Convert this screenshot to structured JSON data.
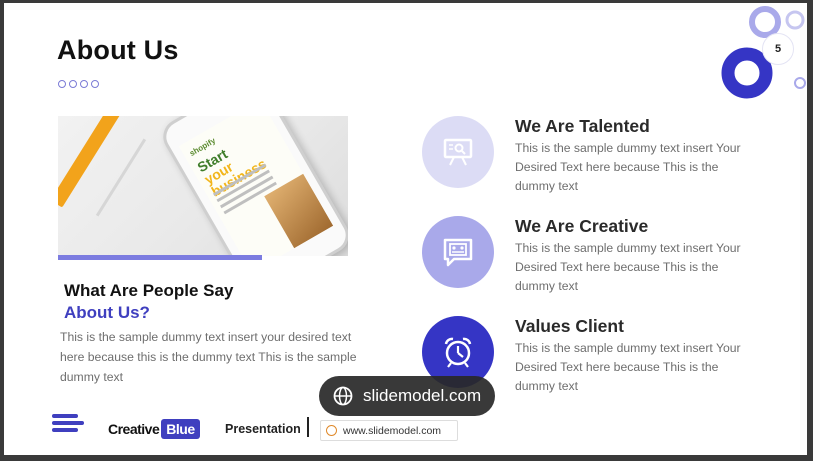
{
  "slide": {
    "title": "About Us",
    "page_number": "5",
    "left": {
      "subtitle_line1": "What Are People Say",
      "subtitle_line2": "About Us?",
      "body": "This is the sample dummy  text insert your desired text here because this is the dummy  text This is the sample dummy  text",
      "phone_brand": "shopify",
      "phone_headline_1": "Start",
      "phone_headline_2": "your business"
    },
    "features": [
      {
        "title": "We Are Talented",
        "text": "This is the sample dummy  text insert Your Desired Text here because This is the dummy  text",
        "icon": "presentation-board-icon",
        "circle_color": "#dcdcf5"
      },
      {
        "title": "We Are Creative",
        "text": "This is the sample dummy  text insert Your Desired Text here because This is the dummy  text",
        "icon": "chat-presentation-icon",
        "circle_color": "#a9a9ea"
      },
      {
        "title": "Values Client",
        "text": "This is the sample dummy  text insert Your Desired Text here because This is the dummy  text",
        "icon": "alarm-clock-icon",
        "circle_color": "#3535c5"
      }
    ],
    "footer": {
      "brand_word": "Creative",
      "brand_badge": "Blue",
      "presentation_label": "Presentation",
      "url": "www.slidemodel.com"
    }
  },
  "watermark": {
    "text": "slidemodel.com"
  },
  "colors": {
    "accent": "#3f3fbf",
    "light_accent": "#7c7ce0"
  }
}
